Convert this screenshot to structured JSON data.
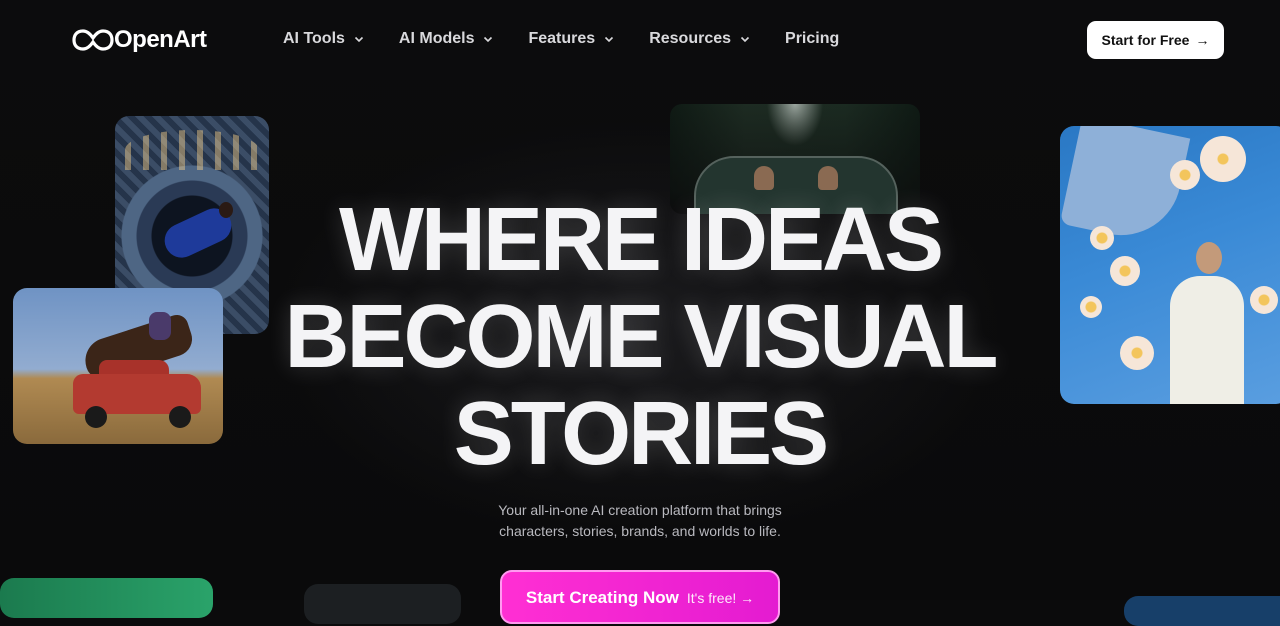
{
  "brand": {
    "name": "OpenArt",
    "logo_icon": "infinity-icon"
  },
  "nav": {
    "items": [
      {
        "label": "AI Tools",
        "has_dropdown": true
      },
      {
        "label": "AI Models",
        "has_dropdown": true
      },
      {
        "label": "Features",
        "has_dropdown": true
      },
      {
        "label": "Resources",
        "has_dropdown": true
      },
      {
        "label": "Pricing",
        "has_dropdown": false
      }
    ],
    "cta": {
      "label": "Start for Free",
      "arrow": "→"
    }
  },
  "hero": {
    "lines": [
      "WHERE IDEAS",
      "BECOME VISUAL",
      "STORIES"
    ],
    "subtitle_line1": "Your all-in-one AI creation platform that brings",
    "subtitle_line2": "characters, stories, brands, and worlds to life.",
    "cta": {
      "label": "Start Creating Now",
      "note": "It's free!",
      "arrow": "→"
    }
  },
  "colors": {
    "background": "#0b0b0c",
    "cta_gradient_start": "#ff2fd3",
    "cta_gradient_end": "#e41bd1",
    "nav_cta_bg": "#ffffff"
  }
}
